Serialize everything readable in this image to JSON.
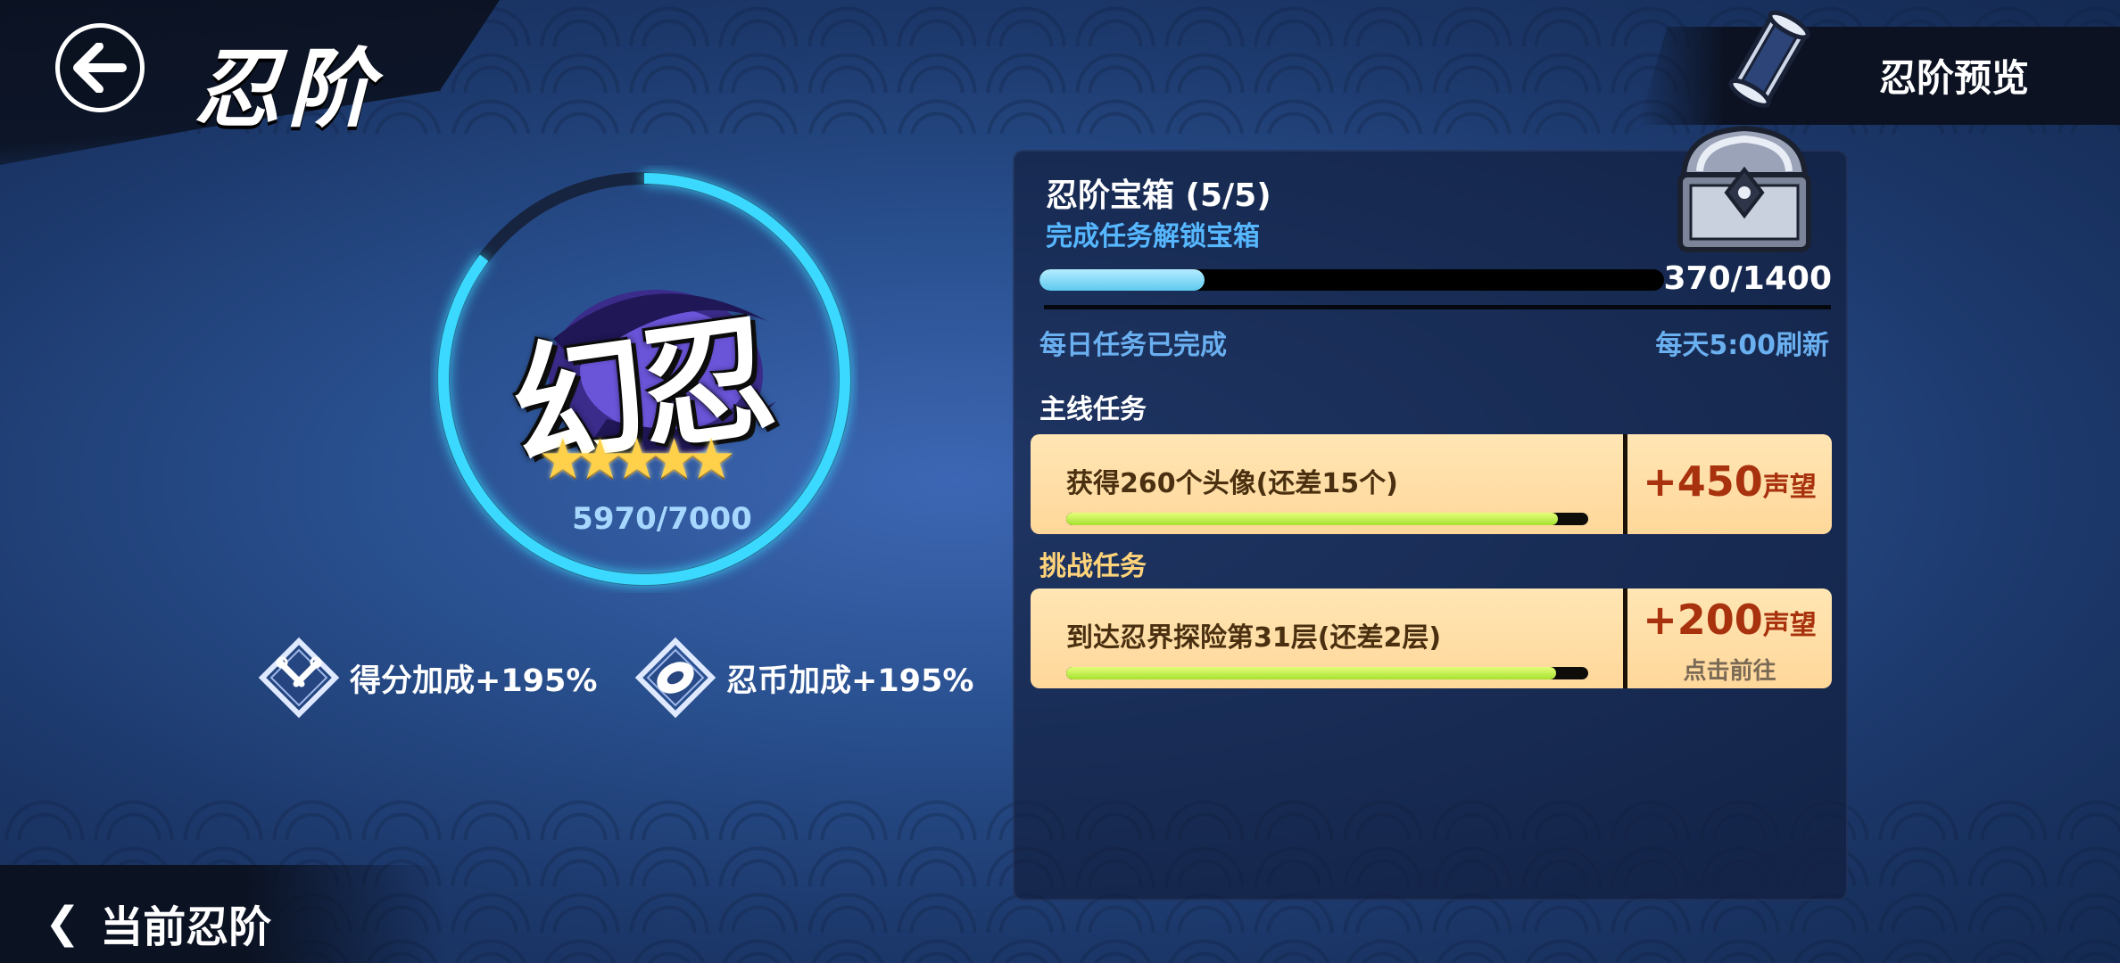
{
  "header": {
    "title": "忍阶",
    "preview_label": "忍阶预览"
  },
  "rank": {
    "name": "幻忍",
    "stars": 5,
    "progress_text": "5970/7000",
    "progress": 0.853
  },
  "bonuses": [
    {
      "label": "得分加成+195%",
      "icon": "kunai-icon"
    },
    {
      "label": "忍币加成+195%",
      "icon": "coin-icon"
    }
  ],
  "chest": {
    "title": "忍阶宝箱 (5/5)",
    "subtitle": "完成任务解锁宝箱",
    "count_text": "370/1400",
    "progress": 0.264,
    "daily_status": "每日任务已完成",
    "refresh_text": "每天5:00刷新"
  },
  "sections": {
    "main": "主线任务",
    "challenge": "挑战任务"
  },
  "tasks": [
    {
      "desc": "获得260个头像(还差15个)",
      "reward": "+450",
      "unit": "声望",
      "progress": 0.942
    },
    {
      "desc": "到达忍界探险第31层(还差2层)",
      "reward": "+200",
      "unit": "声望",
      "progress": 0.939,
      "go_label": "点击前往"
    }
  ],
  "footer": {
    "current_rank_label": "当前忍阶"
  },
  "colors": {
    "ring": "#3ad8ff",
    "chest_bar": "#5ecaf0",
    "task_bar": "#a6e030",
    "reward": "#a8310e"
  }
}
